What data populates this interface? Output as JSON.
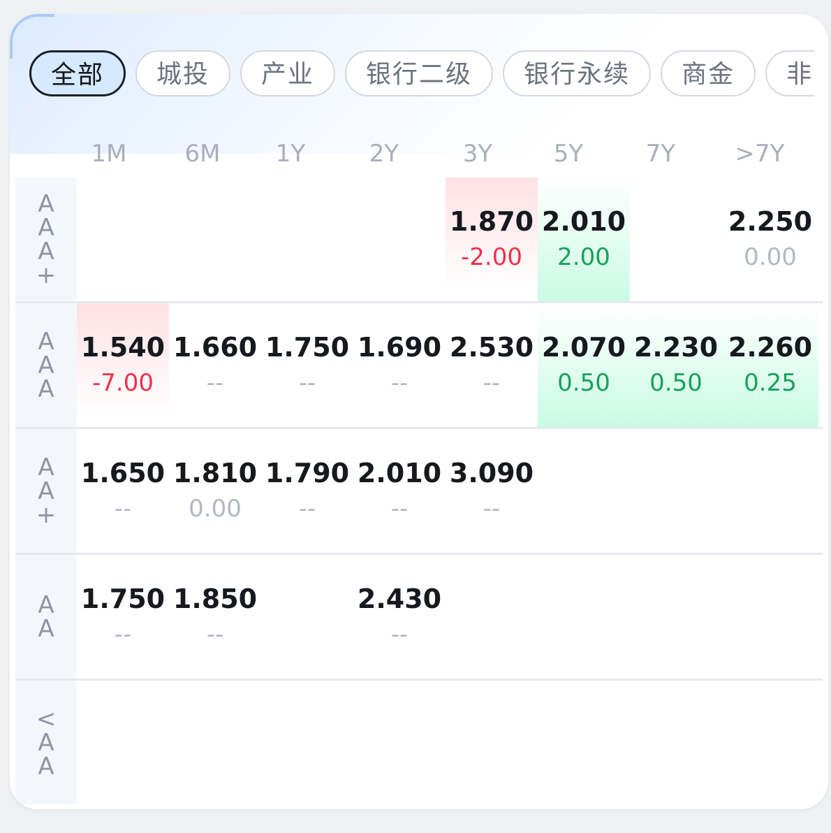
{
  "tabs": [
    {
      "label": "全部",
      "active": true
    },
    {
      "label": "城投",
      "active": false
    },
    {
      "label": "产业",
      "active": false
    },
    {
      "label": "银行二级",
      "active": false
    },
    {
      "label": "银行永续",
      "active": false
    },
    {
      "label": "商金",
      "active": false
    },
    {
      "label": "非二",
      "active": false
    }
  ],
  "tenors": [
    "1M",
    "6M",
    "1Y",
    "2Y",
    "3Y",
    "5Y",
    "7Y",
    ">7Y"
  ],
  "ratings": [
    {
      "label_chars": [
        "A",
        "A",
        "A",
        "+"
      ],
      "name": "AAA+"
    },
    {
      "label_chars": [
        "A",
        "A",
        "A"
      ],
      "name": "AAA"
    },
    {
      "label_chars": [
        "A",
        "A",
        "+"
      ],
      "name": "AA+"
    },
    {
      "label_chars": [
        "A",
        "A"
      ],
      "name": "AA"
    },
    {
      "label_chars": [
        "<",
        "A",
        "A"
      ],
      "name": "<AA"
    }
  ],
  "cells": {
    "r0": [
      null,
      null,
      null,
      null,
      {
        "value": "1.870",
        "change": "-2.00",
        "trend": "up"
      },
      {
        "value": "2.010",
        "change": "2.00",
        "trend": "down"
      },
      null,
      {
        "value": "2.250",
        "change": "0.00",
        "trend": "flat"
      }
    ],
    "r1": [
      {
        "value": "1.540",
        "change": "-7.00",
        "trend": "up"
      },
      {
        "value": "1.660",
        "change": "--",
        "trend": "none"
      },
      {
        "value": "1.750",
        "change": "--",
        "trend": "none"
      },
      {
        "value": "1.690",
        "change": "--",
        "trend": "none"
      },
      {
        "value": "2.530",
        "change": "--",
        "trend": "none"
      },
      {
        "value": "2.070",
        "change": "0.50",
        "trend": "down"
      },
      {
        "value": "2.230",
        "change": "0.50",
        "trend": "down"
      },
      {
        "value": "2.260",
        "change": "0.25",
        "trend": "down"
      }
    ],
    "r2": [
      {
        "value": "1.650",
        "change": "--",
        "trend": "none"
      },
      {
        "value": "1.810",
        "change": "0.00",
        "trend": "flat"
      },
      {
        "value": "1.790",
        "change": "--",
        "trend": "none"
      },
      {
        "value": "2.010",
        "change": "--",
        "trend": "none"
      },
      {
        "value": "3.090",
        "change": "--",
        "trend": "none"
      },
      null,
      null,
      null
    ],
    "r3": [
      {
        "value": "1.750",
        "change": "--",
        "trend": "none"
      },
      {
        "value": "1.850",
        "change": "--",
        "trend": "none"
      },
      null,
      {
        "value": "2.430",
        "change": "--",
        "trend": "none"
      },
      null,
      null,
      null,
      null
    ],
    "r4": [
      null,
      null,
      null,
      null,
      null,
      null,
      null,
      null
    ]
  },
  "colors": {
    "up_text": "#f0304a",
    "down_text": "#17a05a",
    "flat_text": "#b2b8c2",
    "active_chip_bg": "#d5e9ff"
  }
}
